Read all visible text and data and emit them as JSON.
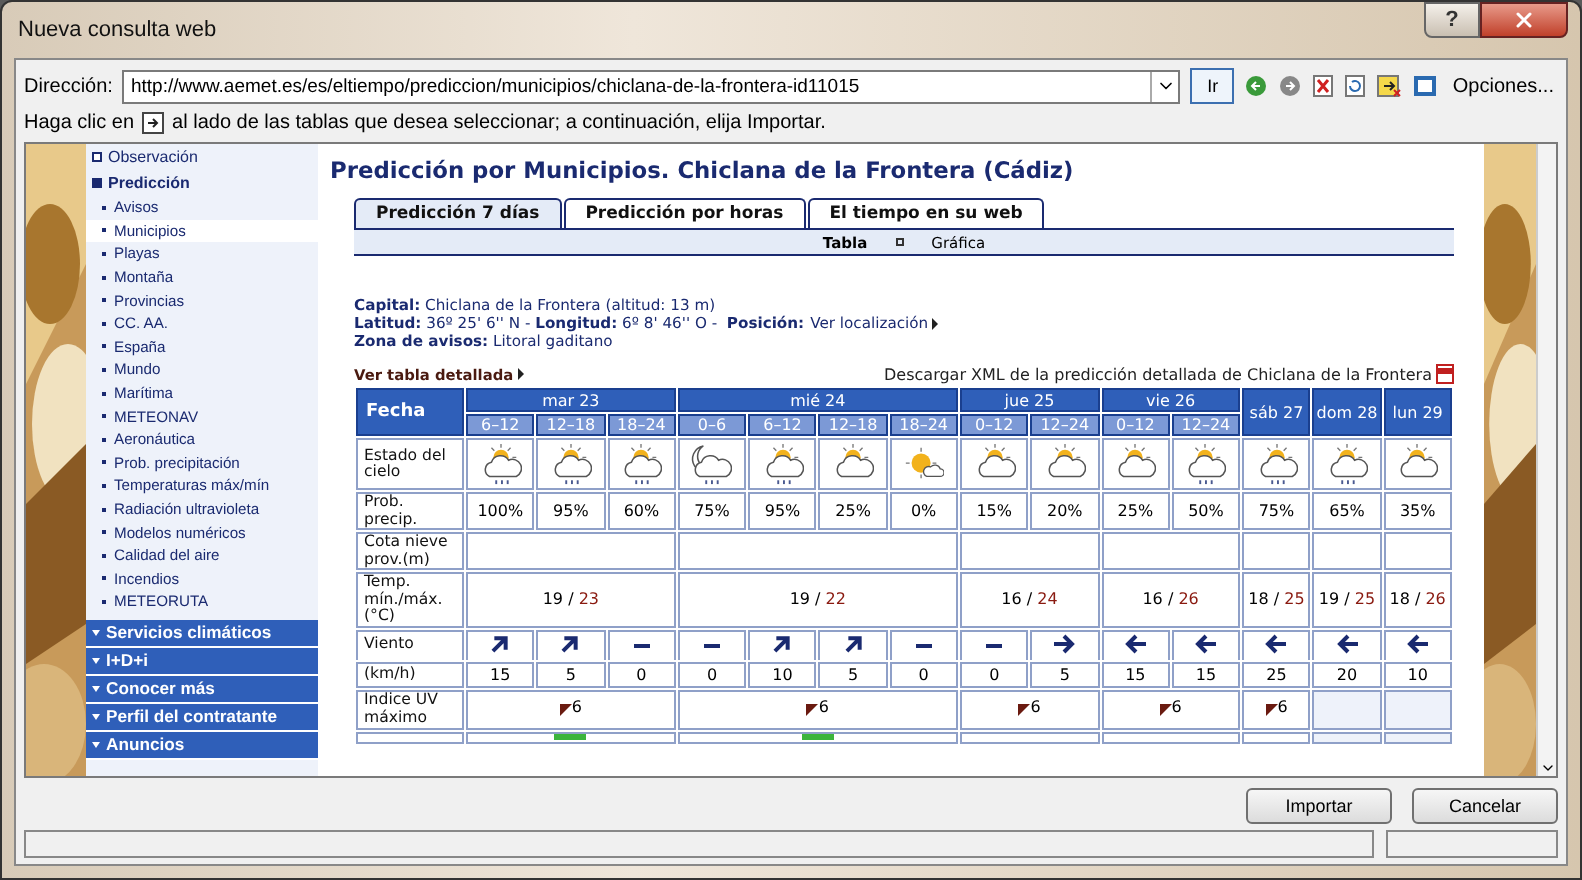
{
  "window": {
    "title": "Nueva consulta web",
    "help": "?"
  },
  "address": {
    "label": "Dirección:",
    "value": "http://www.aemet.es/es/eltiempo/prediccion/municipios/chiclana-de-la-frontera-id11015",
    "go": "Ir",
    "options": "Opciones..."
  },
  "hint": {
    "before": "Haga clic en",
    "after": "al lado de las tablas que desea seleccionar; a continuación, elija Importar."
  },
  "sidebar": {
    "items": [
      {
        "label": "Observación",
        "expanded": false
      },
      {
        "label": "Predicción",
        "expanded": true,
        "children": [
          {
            "label": "Avisos",
            "selected": false
          },
          {
            "label": "Municipios",
            "selected": true
          },
          {
            "label": "Playas",
            "selected": false
          },
          {
            "label": "Montaña",
            "selected": false
          },
          {
            "label": "Provincias",
            "selected": false
          },
          {
            "label": "CC. AA.",
            "selected": false
          },
          {
            "label": "España",
            "selected": false
          },
          {
            "label": "Mundo",
            "selected": false
          },
          {
            "label": "Marítima",
            "selected": false
          },
          {
            "label": "METEONAV",
            "selected": false
          },
          {
            "label": "Aeronáutica",
            "selected": false
          },
          {
            "label": "Prob. precipitación",
            "selected": false
          },
          {
            "label": "Temperaturas máx/mín",
            "selected": false
          },
          {
            "label": "Radiación ultravioleta",
            "selected": false
          },
          {
            "label": "Modelos numéricos",
            "selected": false
          },
          {
            "label": "Calidad del aire",
            "selected": false
          },
          {
            "label": "Incendios",
            "selected": false
          },
          {
            "label": "METEORUTA",
            "selected": false
          }
        ]
      }
    ],
    "sections": [
      "Servicios climáticos",
      "I+D+i",
      "Conocer más",
      "Perfil del contratante",
      "Anuncios"
    ]
  },
  "page": {
    "title": "Predicción por Municipios. Chiclana de la Frontera (Cádiz)",
    "tabs": [
      {
        "label": "Predicción 7 días",
        "selected": true
      },
      {
        "label": "Predicción por horas",
        "selected": false
      },
      {
        "label": "El tiempo en su web",
        "selected": false
      }
    ],
    "views": [
      {
        "label": "Tabla",
        "selected": true
      },
      {
        "label": "Gráfica",
        "selected": false
      }
    ],
    "info": [
      "**Capital:** Chiclana de la Frontera (altitud: 13 m)",
      "**Latitud:** 36º 25' 6'' N - **Longitud:** 6º 8' 46'' O -  **Posición:**",
      "**Zona de avisos:** Litoral gaditano"
    ],
    "position_link": "Ver localización",
    "detail_link": "Ver tabla detallada",
    "xml_link": "Descargar XML de la predicción detallada de Chiclana de la Frontera"
  },
  "table": {
    "date_label": "Fecha",
    "row_labels": {
      "sky": "Estado del cielo",
      "precip": "Prob. precip.",
      "snow": "Cota nieve prov.(m)",
      "temp": "Temp. mín./máx. (°C)",
      "wind": "Viento",
      "speed": "(km/h)",
      "uv": "Indice UV máximo"
    },
    "days": [
      {
        "label": "mar 23",
        "temp_min": "19",
        "temp_sep": "/",
        "temp_max": "23",
        "uv": "6",
        "next_mark": true,
        "columns": [
          {
            "period": "6–12",
            "sky": {
              "kind": "rain"
            },
            "precip": "100%",
            "wind": {
              "kind": "ne"
            },
            "speed": "15"
          },
          {
            "period": "12–18",
            "sky": {
              "kind": "rain"
            },
            "precip": "95%",
            "wind": {
              "kind": "ne"
            },
            "speed": "5"
          },
          {
            "period": "18–24",
            "sky": {
              "kind": "rain"
            },
            "precip": "60%",
            "wind": {
              "kind": "calm"
            },
            "speed": "0"
          }
        ]
      },
      {
        "label": "mié 24",
        "temp_min": "19",
        "temp_sep": "/",
        "temp_max": "22",
        "uv": "6",
        "next_mark": true,
        "columns": [
          {
            "period": "0–6",
            "sky": {
              "kind": "moon"
            },
            "precip": "75%",
            "wind": {
              "kind": "calm"
            },
            "speed": "0"
          },
          {
            "period": "6–12",
            "sky": {
              "kind": "rain"
            },
            "precip": "95%",
            "wind": {
              "kind": "ne"
            },
            "speed": "10"
          },
          {
            "period": "12–18",
            "sky": {
              "kind": "cloud"
            },
            "precip": "25%",
            "wind": {
              "kind": "ne"
            },
            "speed": "5"
          },
          {
            "period": "18–24",
            "sky": {
              "kind": "sun"
            },
            "precip": "0%",
            "wind": {
              "kind": "calm"
            },
            "speed": "0"
          }
        ]
      },
      {
        "label": "jue 25",
        "temp_min": "16",
        "temp_sep": "/",
        "temp_max": "24",
        "uv": "6",
        "next_mark": false,
        "columns": [
          {
            "period": "0–12",
            "sky": {
              "kind": "cloud"
            },
            "precip": "15%",
            "wind": {
              "kind": "calm"
            },
            "speed": "0"
          },
          {
            "period": "12–24",
            "sky": {
              "kind": "cloud"
            },
            "precip": "20%",
            "wind": {
              "kind": "e"
            },
            "speed": "5"
          }
        ]
      },
      {
        "label": "vie 26",
        "temp_min": "16",
        "temp_sep": "/",
        "temp_max": "26",
        "uv": "6",
        "next_mark": false,
        "columns": [
          {
            "period": "0–12",
            "sky": {
              "kind": "cloud"
            },
            "precip": "25%",
            "wind": {
              "kind": "w"
            },
            "speed": "15"
          },
          {
            "period": "12–24",
            "sky": {
              "kind": "rain"
            },
            "precip": "50%",
            "wind": {
              "kind": "w"
            },
            "speed": "15"
          }
        ]
      },
      {
        "label": "sáb 27",
        "temp_min": "18",
        "temp_sep": "/",
        "temp_max": "25",
        "uv": "6",
        "next_mark": false,
        "columns": [
          {
            "sky": {
              "kind": "rain"
            },
            "precip": "75%",
            "wind": {
              "kind": "w"
            },
            "speed": "25"
          }
        ]
      },
      {
        "label": "dom 28",
        "temp_min": "19",
        "temp_sep": "/",
        "temp_max": "25",
        "next_mark": false,
        "columns": [
          {
            "sky": {
              "kind": "rain"
            },
            "precip": "65%",
            "wind": {
              "kind": "w"
            },
            "speed": "20"
          }
        ]
      },
      {
        "label": "lun 29",
        "temp_min": "18",
        "temp_sep": "/",
        "temp_max": "26",
        "next_mark": false,
        "columns": [
          {
            "sky": {
              "kind": "cloud"
            },
            "precip": "35%",
            "wind": {
              "kind": "w"
            },
            "speed": "10"
          }
        ]
      }
    ]
  },
  "buttons": {
    "import": "Importar",
    "cancel": "Cancelar"
  }
}
